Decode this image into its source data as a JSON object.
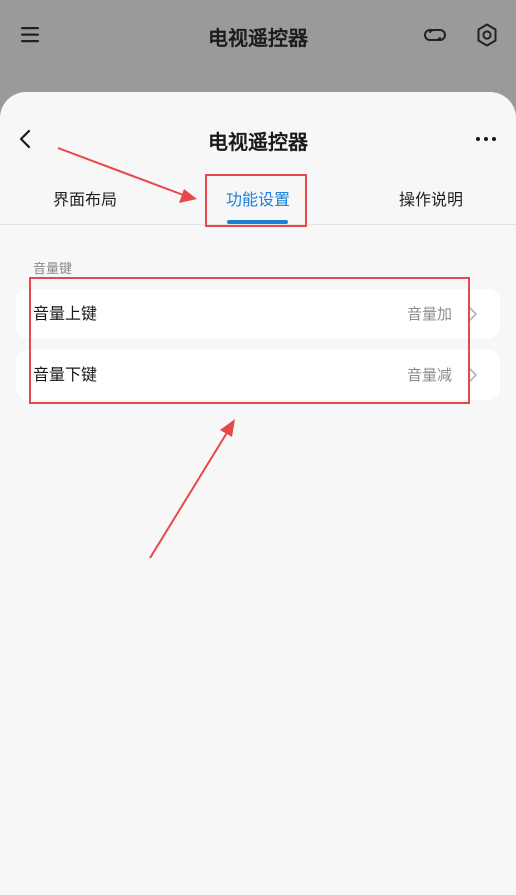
{
  "background_header": {
    "title": "电视遥控器",
    "icons": [
      "menu-icon",
      "link-icon",
      "settings-icon"
    ]
  },
  "sheet": {
    "title": "电视遥控器",
    "icons": [
      "back-chevron-icon",
      "more-icon"
    ],
    "tabs": [
      {
        "label": "界面布局",
        "active": false
      },
      {
        "label": "功能设置",
        "active": true
      },
      {
        "label": "操作说明",
        "active": false
      }
    ],
    "section_label": "音量键",
    "items": [
      {
        "label": "音量上键",
        "value": "音量加"
      },
      {
        "label": "音量下键",
        "value": "音量减"
      }
    ]
  },
  "colors": {
    "accent": "#1a7fd8",
    "annotation": "#e8474b",
    "dim_overlay": "#9a9a9a",
    "sheet_background": "#f7f7f7"
  }
}
